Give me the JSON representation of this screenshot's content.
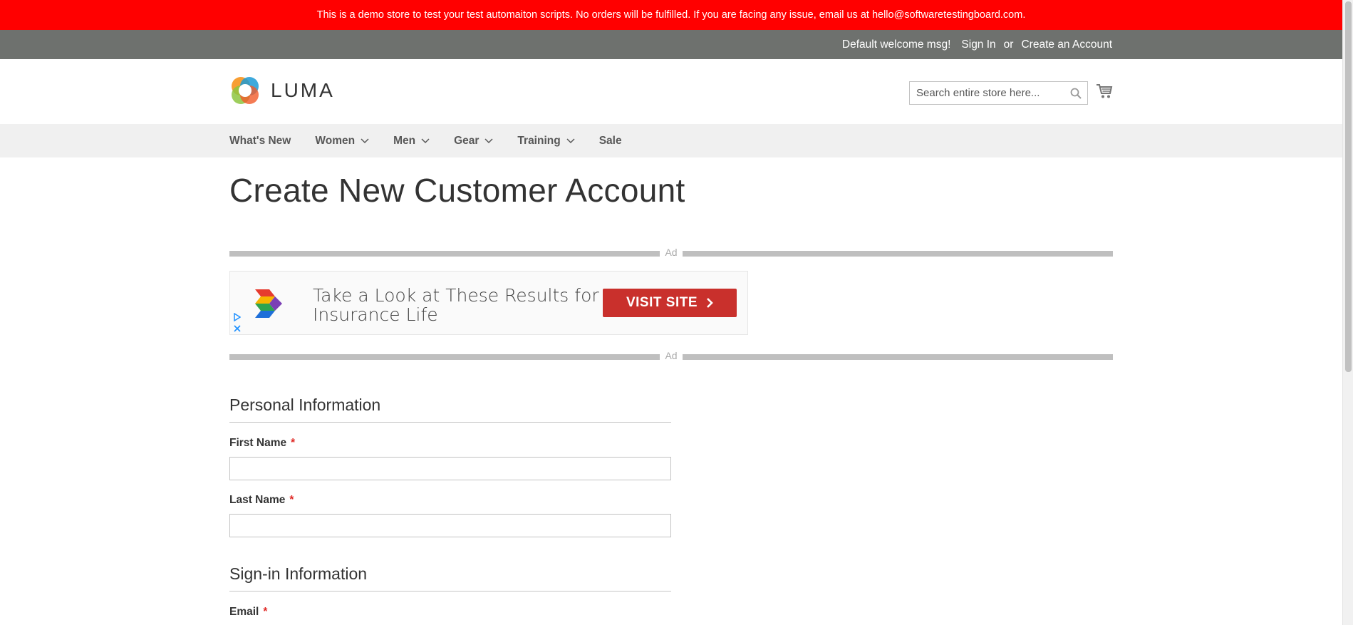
{
  "banner": {
    "text": "This is a demo store to test your test automaiton scripts. No orders will be fulfilled. If you are facing any issue, email us at hello@softwaretestingboard.com."
  },
  "panel": {
    "welcome": "Default welcome msg!",
    "sign_in": "Sign In",
    "or": "or",
    "create_account": "Create an Account"
  },
  "header": {
    "logo_text": "LUMA",
    "search_placeholder": "Search entire store here...",
    "search_value": ""
  },
  "nav": {
    "items": [
      {
        "label": "What's New",
        "has_dropdown": false
      },
      {
        "label": "Women",
        "has_dropdown": true
      },
      {
        "label": "Men",
        "has_dropdown": true
      },
      {
        "label": "Gear",
        "has_dropdown": true
      },
      {
        "label": "Training",
        "has_dropdown": true
      },
      {
        "label": "Sale",
        "has_dropdown": false
      }
    ]
  },
  "page": {
    "title": "Create New Customer Account"
  },
  "ad": {
    "label": "Ad",
    "headline_line1": "Take a Look at These Results for",
    "headline_line2": "Insurance Life",
    "button_label": "VISIT SITE",
    "play_icon": "ad-choices-play-icon",
    "close_icon": "close-icon"
  },
  "form": {
    "personal_section": "Personal Information",
    "first_name_label": "First Name",
    "first_name_value": "",
    "last_name_label": "Last Name",
    "last_name_value": "",
    "signin_section": "Sign-in Information",
    "email_label": "Email",
    "required_marker": "*"
  },
  "colors": {
    "banner": "#ff0000",
    "panel": "#6e716e",
    "nav_bg": "#f0f0f0",
    "ad_button": "#c9302c",
    "required": "#e02b27"
  }
}
